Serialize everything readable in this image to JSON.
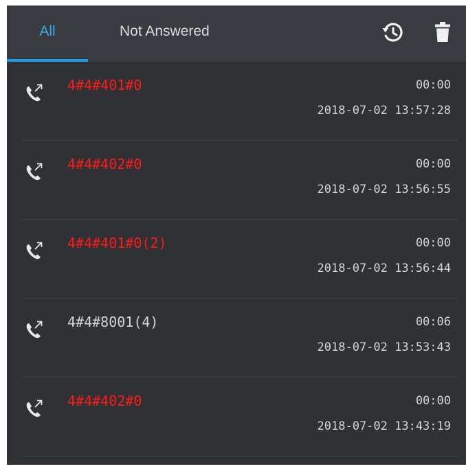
{
  "tabs": {
    "all_label": "All",
    "not_answered_label": "Not Answered",
    "active": "All"
  },
  "toolbar": {
    "history_icon": "history-icon",
    "delete_icon": "trash-icon"
  },
  "colors": {
    "panel_bg": "#2f3134",
    "tab_bar_bg": "#383b40",
    "accent": "#1d9be6",
    "missed_call": "#ff1a1a",
    "text": "#d4d5d7"
  },
  "calls": [
    {
      "name": "4#4#401#0",
      "status": "missed",
      "duration": "00:00",
      "datetime": "2018-07-02 13:57:28"
    },
    {
      "name": "4#4#402#0",
      "status": "missed",
      "duration": "00:00",
      "datetime": "2018-07-02 13:56:55"
    },
    {
      "name": "4#4#401#0(2)",
      "status": "missed",
      "duration": "00:00",
      "datetime": "2018-07-02 13:56:44"
    },
    {
      "name": "4#4#8001(4)",
      "status": "answered",
      "duration": "00:06",
      "datetime": "2018-07-02 13:53:43"
    },
    {
      "name": "4#4#402#0",
      "status": "missed",
      "duration": "00:00",
      "datetime": "2018-07-02 13:43:19"
    }
  ]
}
